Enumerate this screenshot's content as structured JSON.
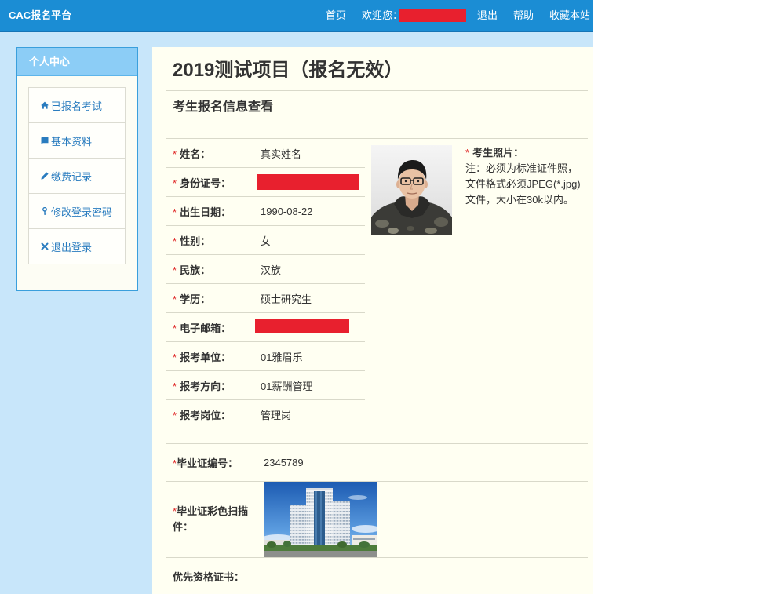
{
  "topbar": {
    "brand": "CAC报名平台",
    "nav": {
      "home": "首页",
      "welcome": "欢迎您：",
      "logout": "退出",
      "help": "帮助",
      "bookmark": "收藏本站"
    }
  },
  "sidebar": {
    "title": "个人中心",
    "items": [
      {
        "label": "已报名考试",
        "icon": "home-icon"
      },
      {
        "label": "基本资料",
        "icon": "book-icon"
      },
      {
        "label": "缴费记录",
        "icon": "pencil-icon"
      },
      {
        "label": "修改登录密码",
        "icon": "key-icon"
      },
      {
        "label": "退出登录",
        "icon": "close-icon"
      }
    ]
  },
  "main": {
    "title": "2019测试项目（报名无效）",
    "subtitle": "考生报名信息查看",
    "required_mark": "*",
    "fields": [
      {
        "label": "姓名：",
        "value": "真实姓名"
      },
      {
        "label": "身份证号：",
        "redacted": true
      },
      {
        "label": "出生日期：",
        "value": "1990-08-22"
      },
      {
        "label": "性别：",
        "value": "女"
      },
      {
        "label": "民族：",
        "value": "汉族"
      },
      {
        "label": "学历：",
        "value": "硕士研究生"
      },
      {
        "label": "电子邮箱：",
        "redacted": true
      },
      {
        "label": "报考单位：",
        "value": "01雅眉乐"
      },
      {
        "label": "报考方向：",
        "value": "01薪酬管理"
      },
      {
        "label": "报考岗位：",
        "value": "管理岗"
      }
    ],
    "photo": {
      "label": "考生照片：",
      "notes": [
        "注：必须为标准证件照，",
        "文件格式必须JPEG(*.jpg)",
        "文件，大小在30k以内。"
      ]
    },
    "certificates": {
      "diploma_number_label": "毕业证编号：",
      "diploma_number": "2345789",
      "diploma_scan_label": "毕业证彩色扫描件：",
      "priority_cert_label": "优先资格证书："
    }
  },
  "colors": {
    "topbar": "#1b8dd4",
    "page_bg": "#c8e6fa",
    "panel_bg": "#fffff2",
    "sidebar_header": "#8ccdf6",
    "sidebar_border": "#3a9fdc",
    "link": "#2a7cbf",
    "required": "#e02424",
    "redaction": "#e8202e"
  }
}
